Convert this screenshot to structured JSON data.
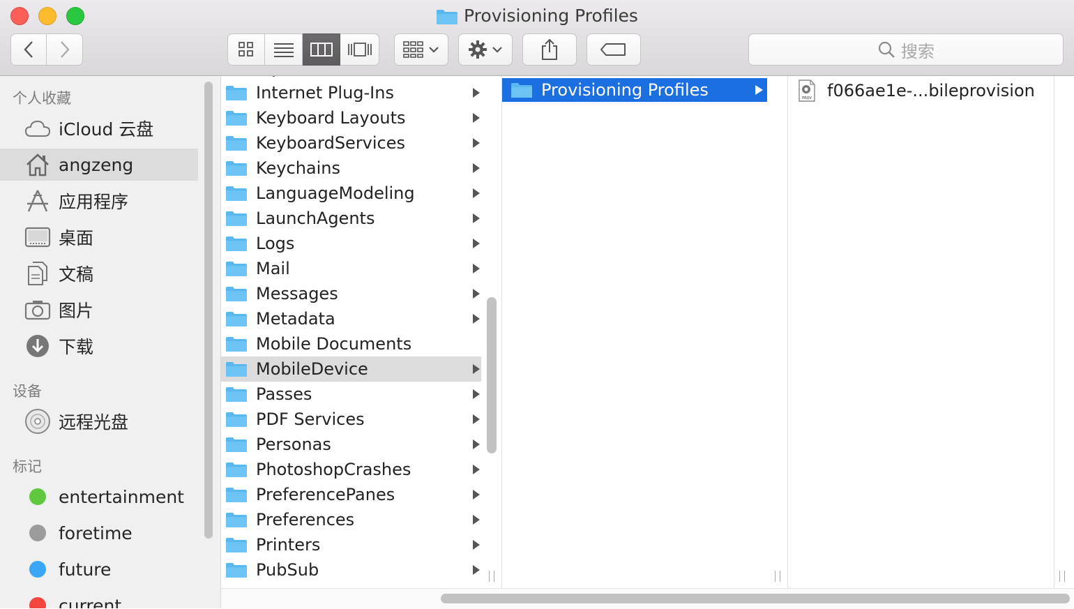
{
  "window": {
    "title": "Provisioning Profiles"
  },
  "search": {
    "placeholder": "搜索"
  },
  "sidebar": {
    "favorites_header": "个人收藏",
    "favorites": [
      {
        "label": "iCloud 云盘",
        "icon": "cloud-icon"
      },
      {
        "label": "angzeng",
        "icon": "home-icon",
        "selected": true
      },
      {
        "label": "应用程序",
        "icon": "applications-icon"
      },
      {
        "label": "桌面",
        "icon": "desktop-icon"
      },
      {
        "label": "文稿",
        "icon": "documents-icon"
      },
      {
        "label": "图片",
        "icon": "camera-icon"
      },
      {
        "label": "下载",
        "icon": "download-icon"
      }
    ],
    "devices_header": "设备",
    "devices": [
      {
        "label": "远程光盘",
        "icon": "disc-icon"
      }
    ],
    "tags_header": "标记",
    "tags": [
      {
        "label": "entertainment",
        "color": "#5fc83e"
      },
      {
        "label": "foretime",
        "color": "#9b9b9b"
      },
      {
        "label": "future",
        "color": "#3aa6f5"
      },
      {
        "label": "current",
        "color": "#f2463e"
      }
    ]
  },
  "column1": {
    "items": [
      {
        "label": "Input Methods",
        "arrow": true
      },
      {
        "label": "Internet Plug-Ins",
        "arrow": true
      },
      {
        "label": "Keyboard Layouts",
        "arrow": true
      },
      {
        "label": "KeyboardServices",
        "arrow": true
      },
      {
        "label": "Keychains",
        "arrow": true
      },
      {
        "label": "LanguageModeling",
        "arrow": true
      },
      {
        "label": "LaunchAgents",
        "arrow": true
      },
      {
        "label": "Logs",
        "arrow": true
      },
      {
        "label": "Mail",
        "arrow": true
      },
      {
        "label": "Messages",
        "arrow": true
      },
      {
        "label": "Metadata",
        "arrow": true
      },
      {
        "label": "Mobile Documents",
        "arrow": false
      },
      {
        "label": "MobileDevice",
        "arrow": true,
        "selected": true
      },
      {
        "label": "Passes",
        "arrow": true
      },
      {
        "label": "PDF Services",
        "arrow": true
      },
      {
        "label": "Personas",
        "arrow": true
      },
      {
        "label": "PhotoshopCrashes",
        "arrow": true
      },
      {
        "label": "PreferencePanes",
        "arrow": true
      },
      {
        "label": "Preferences",
        "arrow": true
      },
      {
        "label": "Printers",
        "arrow": true
      },
      {
        "label": "PubSub",
        "arrow": true
      }
    ]
  },
  "column2": {
    "selected_item": "Provisioning Profiles"
  },
  "column3": {
    "file": {
      "name": "f066ae1e-...bileprovision",
      "icon_badge": "PROV"
    }
  },
  "colors": {
    "selection_blue": "#1b6fe0",
    "folder_blue": "#5ab8f0"
  }
}
